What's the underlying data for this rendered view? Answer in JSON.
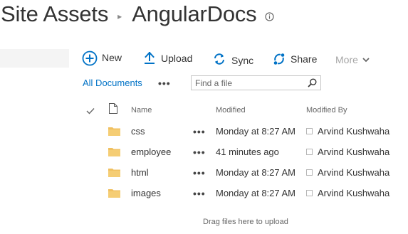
{
  "breadcrumb": {
    "parent": "Site Assets",
    "separator": "▸",
    "current": "AngularDocs",
    "info_icon": "info-icon"
  },
  "toolbar": {
    "new_label": "New",
    "new_icon": "plus-circle-icon",
    "upload_label": "Upload",
    "upload_icon": "upload-arrow-icon",
    "sync_label": "Sync",
    "sync_icon": "sync-icon",
    "share_label": "Share",
    "share_icon": "share-icon",
    "more_label": "More",
    "more_icon": "chevron-down-icon"
  },
  "view": {
    "current_view": "All Documents",
    "ellipsis": "•••"
  },
  "search": {
    "placeholder": "Find a file",
    "value": "",
    "icon": "search-icon"
  },
  "columns": {
    "type_icon": "document-icon",
    "name": "Name",
    "modified": "Modified",
    "modified_by": "Modified By"
  },
  "files": [
    {
      "name": "css",
      "modified": "Monday at 8:27 AM",
      "modified_by": "Arvind Kushwaha",
      "ellipsis": "•••",
      "icon": "folder-icon"
    },
    {
      "name": "employee",
      "modified": "41 minutes ago",
      "modified_by": "Arvind Kushwaha",
      "ellipsis": "•••",
      "icon": "folder-icon"
    },
    {
      "name": "html",
      "modified": "Monday at 8:27 AM",
      "modified_by": "Arvind Kushwaha",
      "ellipsis": "•••",
      "icon": "folder-icon"
    },
    {
      "name": "images",
      "modified": "Monday at 8:27 AM",
      "modified_by": "Arvind Kushwaha",
      "ellipsis": "•••",
      "icon": "folder-icon"
    }
  ],
  "drag_hint": "Drag files here to upload",
  "colors": {
    "accent": "#0072c6",
    "folder": "#f0c060",
    "text": "#333333",
    "muted": "#666666"
  }
}
